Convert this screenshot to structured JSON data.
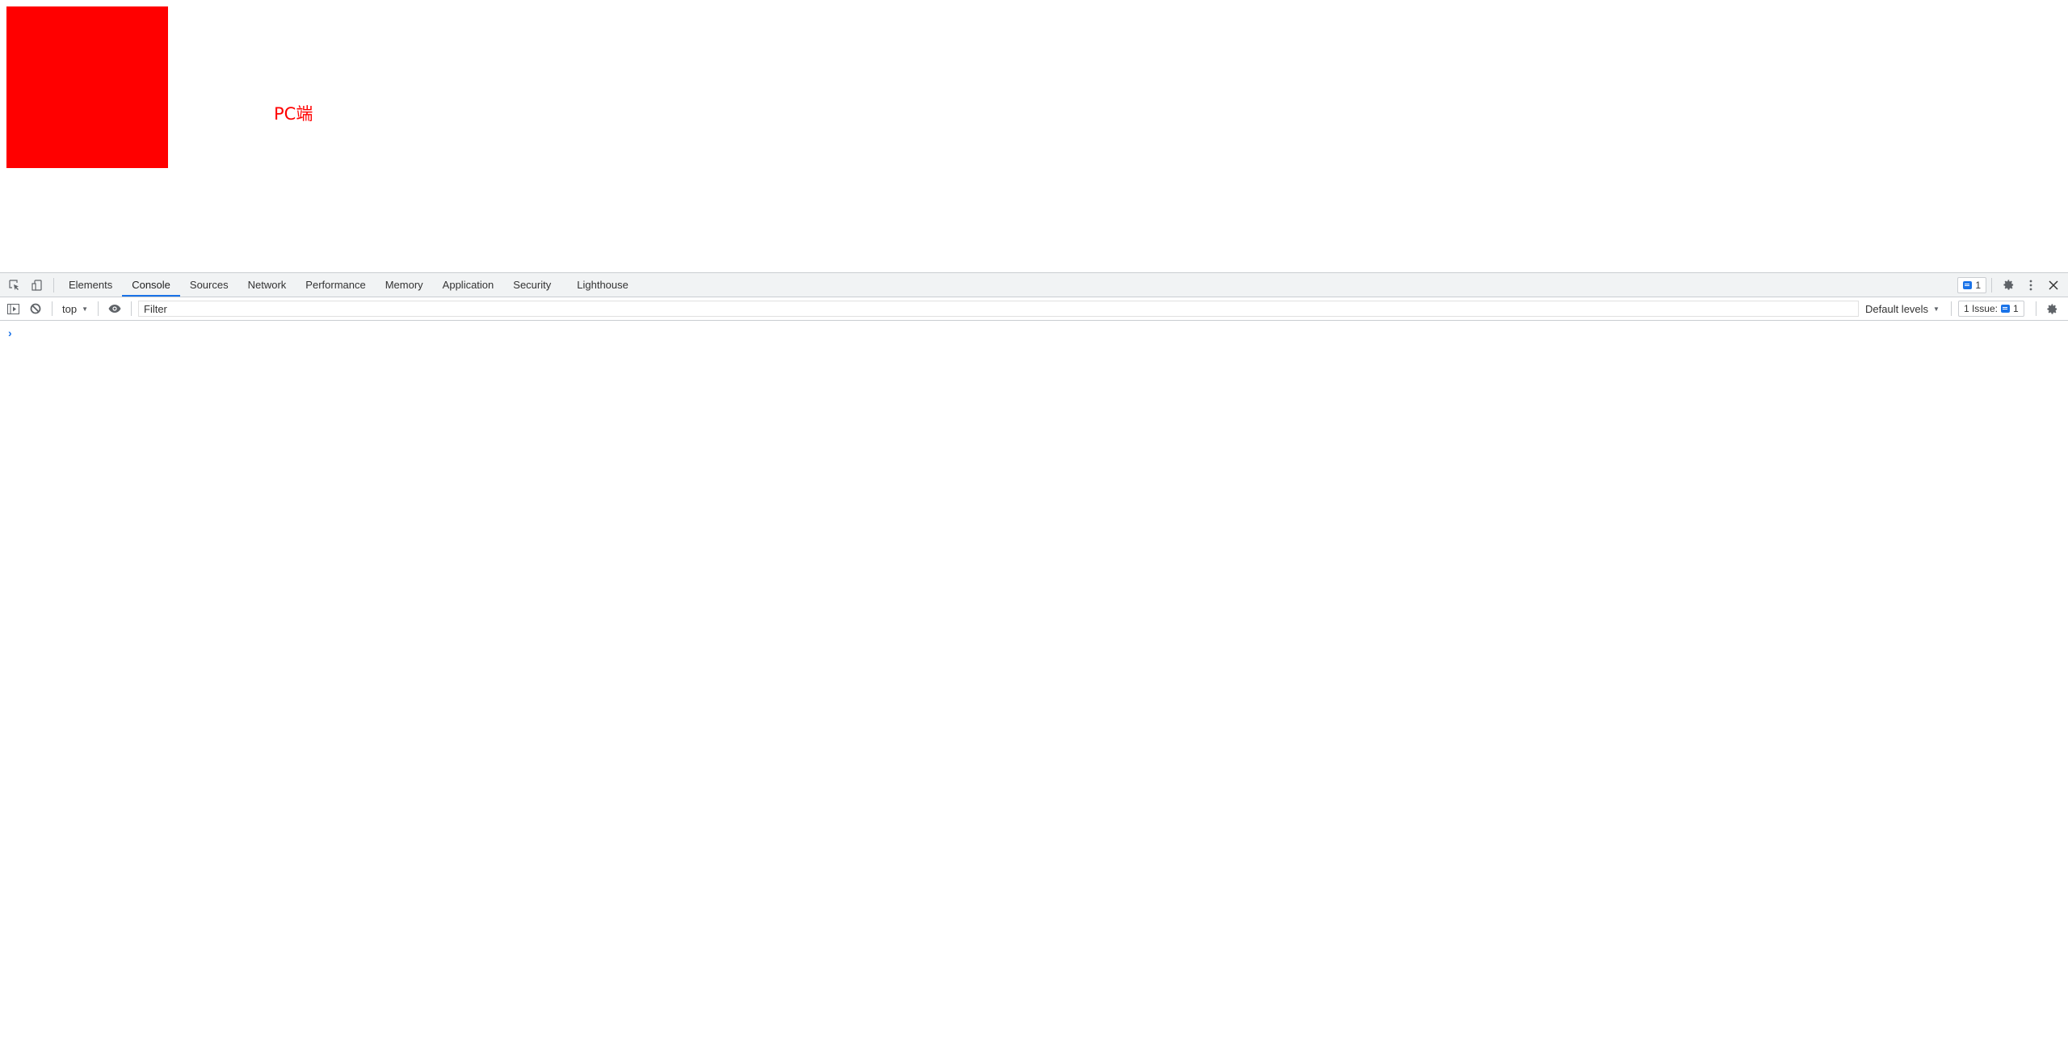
{
  "page": {
    "label": "PC端",
    "box_color": "#ff0000",
    "label_color": "#ff0000"
  },
  "devtools": {
    "left_icons": [
      "inspect-element-icon",
      "device-toolbar-icon"
    ],
    "tabs": [
      {
        "label": "Elements",
        "active": false
      },
      {
        "label": "Console",
        "active": true
      },
      {
        "label": "Sources",
        "active": false
      },
      {
        "label": "Network",
        "active": false
      },
      {
        "label": "Performance",
        "active": false
      },
      {
        "label": "Memory",
        "active": false
      },
      {
        "label": "Application",
        "active": false
      },
      {
        "label": "Security",
        "active": false
      },
      {
        "label": "Lighthouse",
        "active": false
      }
    ],
    "issues_badge_count": "1",
    "right_icons": [
      "settings-icon",
      "more-vertical-icon",
      "close-icon"
    ],
    "accent_color": "#1a73e8"
  },
  "console_toolbar": {
    "context": "top",
    "filter_placeholder": "Filter",
    "filter_value": "",
    "levels": "Default levels",
    "issues_label": "1 Issue:",
    "issues_count": "1"
  },
  "console": {
    "prompt_symbol": "›"
  }
}
